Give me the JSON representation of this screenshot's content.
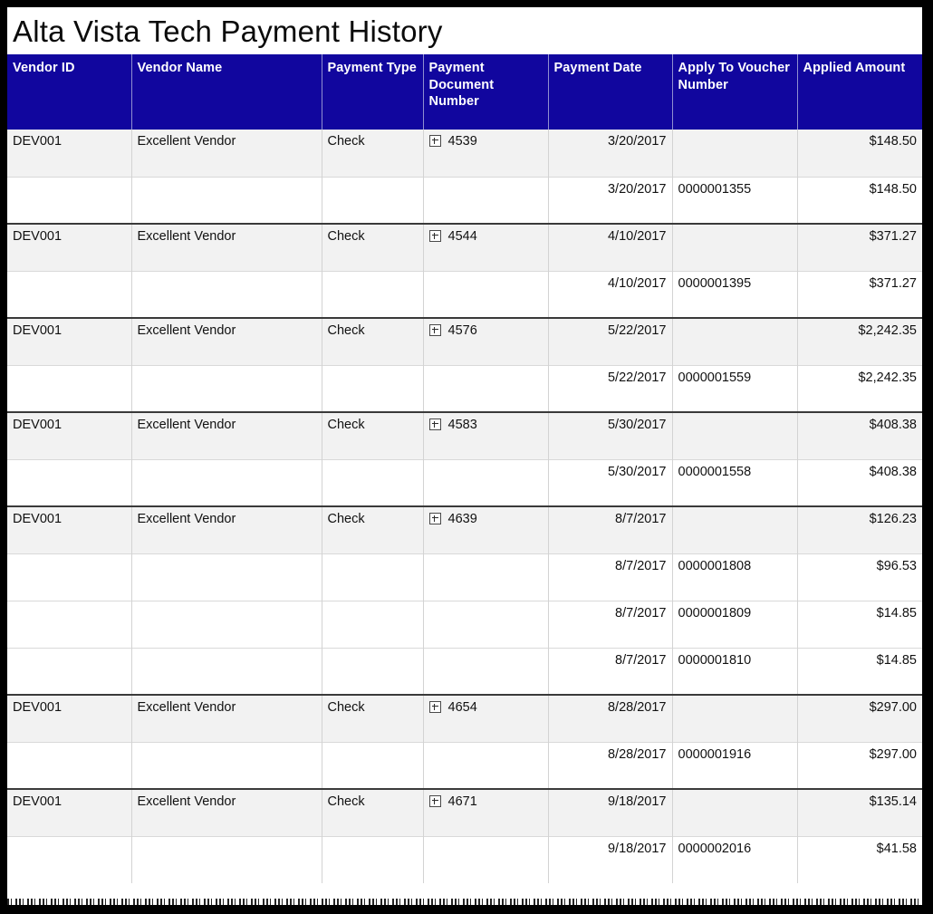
{
  "report": {
    "title": "Alta Vista Tech Payment History"
  },
  "theme": {
    "header_background": "#11069e",
    "header_text": "#ffffff",
    "parent_row_background": "#f2f2f2",
    "detail_row_background": "#ffffff",
    "grid_line": "#d3d3d3",
    "group_rule": "#3a3a3a",
    "page_background": "#ffffff",
    "frame": "#000000",
    "body_text": "#111111"
  },
  "table": {
    "columns": [
      {
        "key": "vendor_id",
        "label": "Vendor ID",
        "align": "left"
      },
      {
        "key": "vendor_name",
        "label": "Vendor Name",
        "align": "left"
      },
      {
        "key": "payment_type",
        "label": "Payment Type",
        "align": "left"
      },
      {
        "key": "doc_number",
        "label": "Payment Document Number",
        "align": "left"
      },
      {
        "key": "payment_date",
        "label": "Payment Date",
        "align": "right"
      },
      {
        "key": "voucher",
        "label": "Apply To Voucher Number",
        "align": "left"
      },
      {
        "key": "amount",
        "label": "Applied Amount",
        "align": "right"
      }
    ],
    "expander_icon": "expand-plus-icon",
    "groups": [
      {
        "vendor_id": "DEV001",
        "vendor_name": "Excellent Vendor",
        "payment_type": "Check",
        "doc_number": "4539",
        "payment_date": "3/20/2017",
        "voucher": "",
        "amount": "$148.50",
        "details": [
          {
            "payment_date": "3/20/2017",
            "voucher": "0000001355",
            "amount": "$148.50"
          }
        ]
      },
      {
        "vendor_id": "DEV001",
        "vendor_name": "Excellent Vendor",
        "payment_type": "Check",
        "doc_number": "4544",
        "payment_date": "4/10/2017",
        "voucher": "",
        "amount": "$371.27",
        "details": [
          {
            "payment_date": "4/10/2017",
            "voucher": "0000001395",
            "amount": "$371.27"
          }
        ]
      },
      {
        "vendor_id": "DEV001",
        "vendor_name": "Excellent Vendor",
        "payment_type": "Check",
        "doc_number": "4576",
        "payment_date": "5/22/2017",
        "voucher": "",
        "amount": "$2,242.35",
        "details": [
          {
            "payment_date": "5/22/2017",
            "voucher": "0000001559",
            "amount": "$2,242.35"
          }
        ]
      },
      {
        "vendor_id": "DEV001",
        "vendor_name": "Excellent Vendor",
        "payment_type": "Check",
        "doc_number": "4583",
        "payment_date": "5/30/2017",
        "voucher": "",
        "amount": "$408.38",
        "details": [
          {
            "payment_date": "5/30/2017",
            "voucher": "0000001558",
            "amount": "$408.38"
          }
        ]
      },
      {
        "vendor_id": "DEV001",
        "vendor_name": "Excellent Vendor",
        "payment_type": "Check",
        "doc_number": "4639",
        "payment_date": "8/7/2017",
        "voucher": "",
        "amount": "$126.23",
        "details": [
          {
            "payment_date": "8/7/2017",
            "voucher": "0000001808",
            "amount": "$96.53"
          },
          {
            "payment_date": "8/7/2017",
            "voucher": "0000001809",
            "amount": "$14.85"
          },
          {
            "payment_date": "8/7/2017",
            "voucher": "0000001810",
            "amount": "$14.85"
          }
        ]
      },
      {
        "vendor_id": "DEV001",
        "vendor_name": "Excellent Vendor",
        "payment_type": "Check",
        "doc_number": "4654",
        "payment_date": "8/28/2017",
        "voucher": "",
        "amount": "$297.00",
        "details": [
          {
            "payment_date": "8/28/2017",
            "voucher": "0000001916",
            "amount": "$297.00"
          }
        ]
      },
      {
        "vendor_id": "DEV001",
        "vendor_name": "Excellent Vendor",
        "payment_type": "Check",
        "doc_number": "4671",
        "payment_date": "9/18/2017",
        "voucher": "",
        "amount": "$135.14",
        "details": [
          {
            "payment_date": "9/18/2017",
            "voucher": "0000002016",
            "amount": "$41.58"
          }
        ]
      }
    ]
  }
}
